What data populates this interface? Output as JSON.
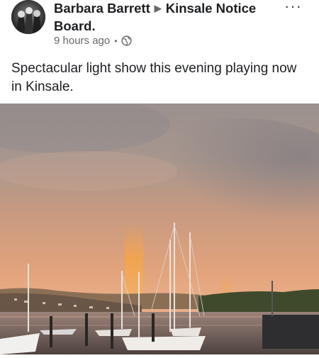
{
  "post": {
    "author": "Barbara Barrett",
    "group": "Kinsale Notice Board.",
    "time": "9 hours ago",
    "separator": "•",
    "more": "···",
    "text": "Spectacular light show this evening playing now in Kinsale."
  },
  "icons": {
    "audience": "globe-icon",
    "menu": "more-options-icon",
    "arrow": "triangle-right-icon"
  },
  "colors": {
    "secondary_text": "#65676b",
    "primary_text": "#1c1e21",
    "sky_top": "#9d908c",
    "sky_glow": "#e8a77a",
    "rainbow": "#f2a04a",
    "water": "#6a5d58"
  }
}
